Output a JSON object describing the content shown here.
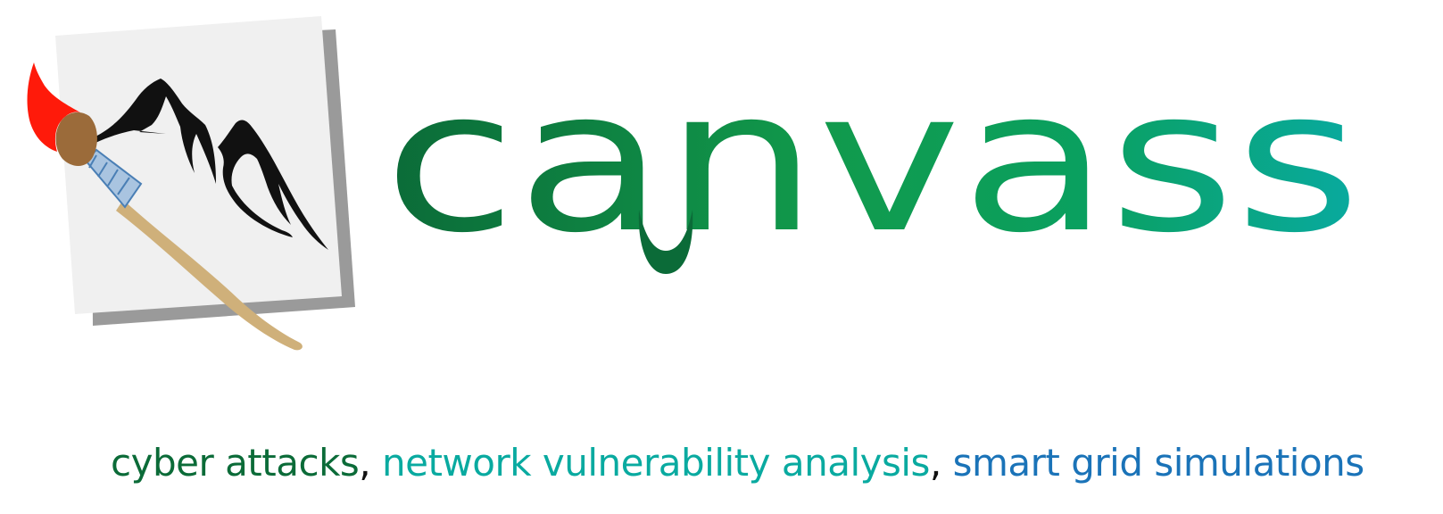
{
  "logo": {
    "wordmark": "canvass",
    "wordmark_letters": [
      "c",
      "a",
      "n",
      "v",
      "a",
      "s",
      "s"
    ],
    "icon": "paintbrush-canvas-mountain-icon"
  },
  "tagline": {
    "part1": "cyber attacks",
    "sep1": ", ",
    "part2": "network vulnerability analysis",
    "sep2": ", ",
    "part3": "smart grid simulations"
  },
  "colors": {
    "dark_green": "#0b6b38",
    "green": "#119a4c",
    "teal": "#09aaa0",
    "blue": "#1a73b8",
    "black": "#111111",
    "brush_red": "#ff1a0a",
    "brush_handle": "#cfb07a",
    "brush_ferrule": "#a9c4e0",
    "canvas_grey": "#f0f0f0",
    "canvas_shadow": "#9a9a9a"
  }
}
